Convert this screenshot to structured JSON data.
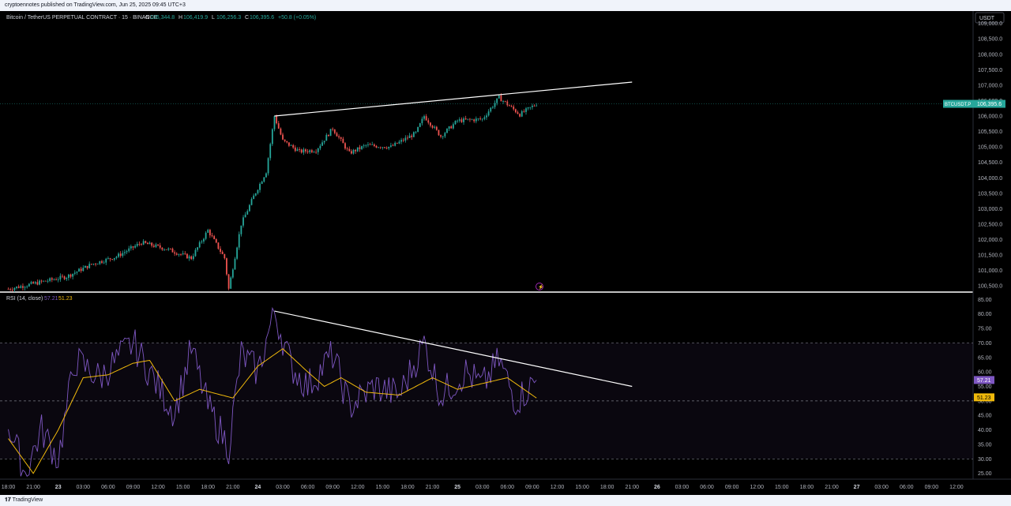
{
  "publish_note": "cryptoennotes published on TradingView.com, Jun 25, 2025 09:45 UTC+3",
  "brand": "TradingView",
  "currency_button": "USDT",
  "colors": {
    "up": "#26a69a",
    "down": "#ef5350",
    "rsi": "#7e57c2",
    "rsi_ma": "#f0b90b",
    "trend": "#ffffff",
    "price_tag": "#26a69a"
  },
  "chart_data": [
    {
      "type": "candlestick",
      "symbol_title": "Bitcoin / TetherUS PERPETUAL CONTRACT · 15 · BINANCE",
      "ohlc": {
        "o_label": "O",
        "o": "106,344.8",
        "h_label": "H",
        "h": "106,419.9",
        "l_label": "L",
        "l": "106,256.3",
        "c_label": "C",
        "c": "106,395.6",
        "change": "+50.8 (+0.05%)"
      },
      "price_tag": {
        "symbol": "BTCUSDT.P",
        "value": "106,395.6"
      },
      "y_ticks": [
        "109,000.0",
        "108,500.0",
        "108,000.0",
        "107,500.0",
        "107,000.0",
        "106,500.0",
        "106,000.0",
        "105,500.0",
        "105,000.0",
        "104,500.0",
        "104,000.0",
        "103,500.0",
        "103,000.0",
        "102,500.0",
        "102,000.0",
        "101,500.0",
        "101,000.0",
        "100,500.0"
      ],
      "ylim": [
        100300,
        109400
      ],
      "trendline": {
        "from": [
          "Jun 24 02:00",
          106000
        ],
        "to": [
          "Jun 25 21:00",
          107100
        ]
      },
      "waypoints": [
        {
          "t": "Jun 22 18:00",
          "price": 100400
        },
        {
          "t": "Jun 23 01:00",
          "price": 100800
        },
        {
          "t": "Jun 23 04:00",
          "price": 101200
        },
        {
          "t": "Jun 23 07:00",
          "price": 101450
        },
        {
          "t": "Jun 23 10:00",
          "price": 101900
        },
        {
          "t": "Jun 23 13:00",
          "price": 101700
        },
        {
          "t": "Jun 23 16:00",
          "price": 101400
        },
        {
          "t": "Jun 23 18:00",
          "price": 102300
        },
        {
          "t": "Jun 23 20:00",
          "price": 101400
        },
        {
          "t": "Jun 23 20:30",
          "price": 100400
        },
        {
          "t": "Jun 23 22:00",
          "price": 102500
        },
        {
          "t": "Jun 23 23:30",
          "price": 103400
        },
        {
          "t": "Jun 24 01:00",
          "price": 104200
        },
        {
          "t": "Jun 24 02:00",
          "price": 106000
        },
        {
          "t": "Jun 24 03:00",
          "price": 105200
        },
        {
          "t": "Jun 24 05:00",
          "price": 104850
        },
        {
          "t": "Jun 24 07:00",
          "price": 104900
        },
        {
          "t": "Jun 24 09:00",
          "price": 105600
        },
        {
          "t": "Jun 24 11:00",
          "price": 104800
        },
        {
          "t": "Jun 24 13:00",
          "price": 105050
        },
        {
          "t": "Jun 24 16:00",
          "price": 105000
        },
        {
          "t": "Jun 24 19:00",
          "price": 105450
        },
        {
          "t": "Jun 24 20:00",
          "price": 106000
        },
        {
          "t": "Jun 24 22:00",
          "price": 105350
        },
        {
          "t": "Jun 25 00:00",
          "price": 105850
        },
        {
          "t": "Jun 25 03:00",
          "price": 105900
        },
        {
          "t": "Jun 25 05:00",
          "price": 106600
        },
        {
          "t": "Jun 25 07:30",
          "price": 106050
        },
        {
          "t": "Jun 25 09:30",
          "price": 106395
        }
      ]
    },
    {
      "type": "line",
      "indicator": "RSI",
      "indicator_params": "(14, close)",
      "rsi_value": "57.21",
      "ma_value": "51.23",
      "y_ticks": [
        "85.00",
        "80.00",
        "75.00",
        "70.00",
        "65.00",
        "60.00",
        "55.00",
        "50.00",
        "45.00",
        "40.00",
        "35.00",
        "30.00",
        "25.00"
      ],
      "ylim": [
        23,
        87
      ],
      "bands": {
        "upper": 70,
        "middle": 50,
        "lower": 30
      },
      "trendline": {
        "from": [
          "Jun 24 02:00",
          81
        ],
        "to": [
          "Jun 25 21:00",
          55
        ]
      },
      "rsi_waypoints": [
        {
          "t": "Jun 22 18:00",
          "v": 42
        },
        {
          "t": "Jun 22 20:00",
          "v": 25
        },
        {
          "t": "Jun 22 22:00",
          "v": 40
        },
        {
          "t": "Jun 23 00:00",
          "v": 30
        },
        {
          "t": "Jun 23 02:00",
          "v": 64
        },
        {
          "t": "Jun 23 05:00",
          "v": 58
        },
        {
          "t": "Jun 23 09:00",
          "v": 70
        },
        {
          "t": "Jun 23 12:00",
          "v": 55
        },
        {
          "t": "Jun 23 14:00",
          "v": 46
        },
        {
          "t": "Jun 23 16:00",
          "v": 68
        },
        {
          "t": "Jun 23 18:00",
          "v": 48
        },
        {
          "t": "Jun 23 20:30",
          "v": 34
        },
        {
          "t": "Jun 23 22:00",
          "v": 66
        },
        {
          "t": "Jun 24 00:00",
          "v": 60
        },
        {
          "t": "Jun 24 02:00",
          "v": 81
        },
        {
          "t": "Jun 24 04:00",
          "v": 62
        },
        {
          "t": "Jun 24 06:00",
          "v": 55
        },
        {
          "t": "Jun 24 09:00",
          "v": 66
        },
        {
          "t": "Jun 24 11:00",
          "v": 48
        },
        {
          "t": "Jun 24 14:00",
          "v": 55
        },
        {
          "t": "Jun 24 17:00",
          "v": 52
        },
        {
          "t": "Jun 24 20:00",
          "v": 70
        },
        {
          "t": "Jun 24 22:00",
          "v": 52
        },
        {
          "t": "Jun 25 01:00",
          "v": 60
        },
        {
          "t": "Jun 25 03:00",
          "v": 55
        },
        {
          "t": "Jun 25 05:00",
          "v": 64
        },
        {
          "t": "Jun 25 07:00",
          "v": 50
        },
        {
          "t": "Jun 25 09:30",
          "v": 57
        }
      ],
      "ma_waypoints": [
        {
          "t": "Jun 22 18:00",
          "v": 37
        },
        {
          "t": "Jun 22 21:00",
          "v": 25
        },
        {
          "t": "Jun 23 00:00",
          "v": 40
        },
        {
          "t": "Jun 23 03:00",
          "v": 58
        },
        {
          "t": "Jun 23 06:00",
          "v": 59
        },
        {
          "t": "Jun 23 09:00",
          "v": 63
        },
        {
          "t": "Jun 23 11:00",
          "v": 64
        },
        {
          "t": "Jun 23 14:00",
          "v": 50
        },
        {
          "t": "Jun 23 17:00",
          "v": 54
        },
        {
          "t": "Jun 23 21:00",
          "v": 51
        },
        {
          "t": "Jun 24 00:00",
          "v": 62
        },
        {
          "t": "Jun 24 03:00",
          "v": 68
        },
        {
          "t": "Jun 24 06:00",
          "v": 60
        },
        {
          "t": "Jun 24 08:00",
          "v": 55
        },
        {
          "t": "Jun 24 10:00",
          "v": 58
        },
        {
          "t": "Jun 24 13:00",
          "v": 53
        },
        {
          "t": "Jun 24 17:00",
          "v": 52
        },
        {
          "t": "Jun 24 21:00",
          "v": 58
        },
        {
          "t": "Jun 25 00:00",
          "v": 54
        },
        {
          "t": "Jun 25 03:00",
          "v": 56
        },
        {
          "t": "Jun 25 06:00",
          "v": 58
        },
        {
          "t": "Jun 25 09:30",
          "v": 51
        }
      ]
    }
  ],
  "x_axis": {
    "range": [
      "Jun 22 17:00",
      "Jun 27 14:00"
    ],
    "ticks": [
      {
        "t": "Jun 22 18:00",
        "label": "18:00"
      },
      {
        "t": "Jun 22 21:00",
        "label": "21:00"
      },
      {
        "t": "Jun 23 00:00",
        "label": "23",
        "bold": true
      },
      {
        "t": "Jun 23 03:00",
        "label": "03:00"
      },
      {
        "t": "Jun 23 06:00",
        "label": "06:00"
      },
      {
        "t": "Jun 23 09:00",
        "label": "09:00"
      },
      {
        "t": "Jun 23 12:00",
        "label": "12:00"
      },
      {
        "t": "Jun 23 15:00",
        "label": "15:00"
      },
      {
        "t": "Jun 23 18:00",
        "label": "18:00"
      },
      {
        "t": "Jun 23 21:00",
        "label": "21:00"
      },
      {
        "t": "Jun 24 00:00",
        "label": "24",
        "bold": true
      },
      {
        "t": "Jun 24 03:00",
        "label": "03:00"
      },
      {
        "t": "Jun 24 06:00",
        "label": "06:00"
      },
      {
        "t": "Jun 24 09:00",
        "label": "09:00"
      },
      {
        "t": "Jun 24 12:00",
        "label": "12:00"
      },
      {
        "t": "Jun 24 15:00",
        "label": "15:00"
      },
      {
        "t": "Jun 24 18:00",
        "label": "18:00"
      },
      {
        "t": "Jun 24 21:00",
        "label": "21:00"
      },
      {
        "t": "Jun 25 00:00",
        "label": "25",
        "bold": true
      },
      {
        "t": "Jun 25 03:00",
        "label": "03:00"
      },
      {
        "t": "Jun 25 06:00",
        "label": "06:00"
      },
      {
        "t": "Jun 25 09:00",
        "label": "09:00"
      },
      {
        "t": "Jun 25 12:00",
        "label": "12:00"
      },
      {
        "t": "Jun 25 15:00",
        "label": "15:00"
      },
      {
        "t": "Jun 25 18:00",
        "label": "18:00"
      },
      {
        "t": "Jun 25 21:00",
        "label": "21:00"
      },
      {
        "t": "Jun 26 00:00",
        "label": "26",
        "bold": true
      },
      {
        "t": "Jun 26 03:00",
        "label": "03:00"
      },
      {
        "t": "Jun 26 06:00",
        "label": "06:00"
      },
      {
        "t": "Jun 26 09:00",
        "label": "09:00"
      },
      {
        "t": "Jun 26 12:00",
        "label": "12:00"
      },
      {
        "t": "Jun 26 15:00",
        "label": "15:00"
      },
      {
        "t": "Jun 26 18:00",
        "label": "18:00"
      },
      {
        "t": "Jun 26 21:00",
        "label": "21:00"
      },
      {
        "t": "Jun 27 00:00",
        "label": "27",
        "bold": true
      },
      {
        "t": "Jun 27 03:00",
        "label": "03:00"
      },
      {
        "t": "Jun 27 06:00",
        "label": "06:00"
      },
      {
        "t": "Jun 27 09:00",
        "label": "09:00"
      },
      {
        "t": "Jun 27 12:00",
        "label": "12:00"
      }
    ]
  }
}
